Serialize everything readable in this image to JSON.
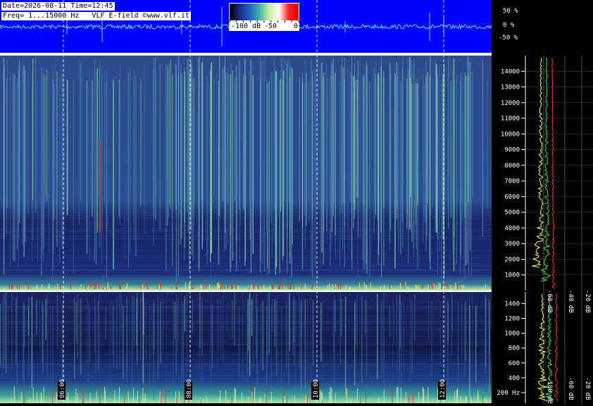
{
  "header": {
    "line1": "Date=2026-08-11 Time=12:45",
    "line2": "Freq= 1...15000 Hz   VLF E-field ©www.vlf.it"
  },
  "colorbar": {
    "labels": [
      "-100 dB",
      "-50",
      "0"
    ],
    "stops": [
      "#000000",
      "#1a2a80",
      "#2060c0",
      "#40b0a0",
      "#c0f0a0",
      "#ffffff",
      "#ff2020",
      "#e00000"
    ]
  },
  "waveform_axis": {
    "labels": [
      "50 %",
      "0 %",
      "-50 %"
    ],
    "background": "#0000ff",
    "trace_color": "#60e0ff"
  },
  "chart_data": [
    {
      "type": "heatmap",
      "panel": "main-spectrogram",
      "yaxis_ticks": [
        "14000",
        "13000",
        "12000",
        "11000",
        "10000",
        "9000",
        "8000",
        "7000",
        "6000",
        "5000",
        "4000",
        "3000",
        "2000",
        "1000"
      ],
      "ylim": [
        0,
        15000
      ],
      "xaxis_ticks": [
        "06:00",
        "08:00",
        "10:00",
        "12:00"
      ],
      "spectrum_axis_labels": [
        "-60 dB",
        "-40 dB",
        "-20 dB"
      ],
      "grid": true
    },
    {
      "type": "heatmap",
      "panel": "low-spectrogram",
      "yaxis_ticks": [
        "1400",
        "1200",
        "1000",
        "800",
        "600",
        "400",
        "200 Hz"
      ],
      "ylim": [
        0,
        1500
      ],
      "xaxis_ticks": [
        "06:00",
        "08:00",
        "10:00",
        "12:00"
      ],
      "spectrum_axis_labels": [
        "-100 dB",
        "-60 dB",
        "-20 dB"
      ],
      "grid": true
    }
  ]
}
